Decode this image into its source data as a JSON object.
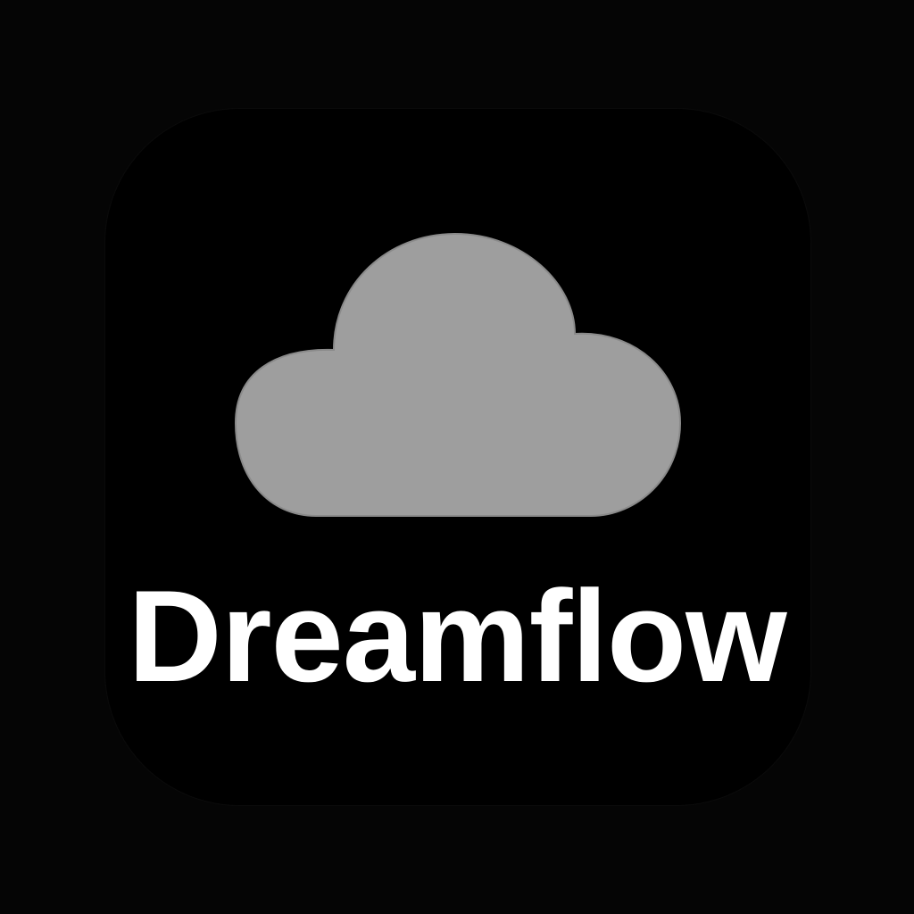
{
  "app": {
    "name": "Dreamflow",
    "icon": "cloud-icon",
    "colors": {
      "background": "#050505",
      "tile": "#000000",
      "cloud": "#9e9e9e",
      "text": "#ffffff"
    }
  }
}
